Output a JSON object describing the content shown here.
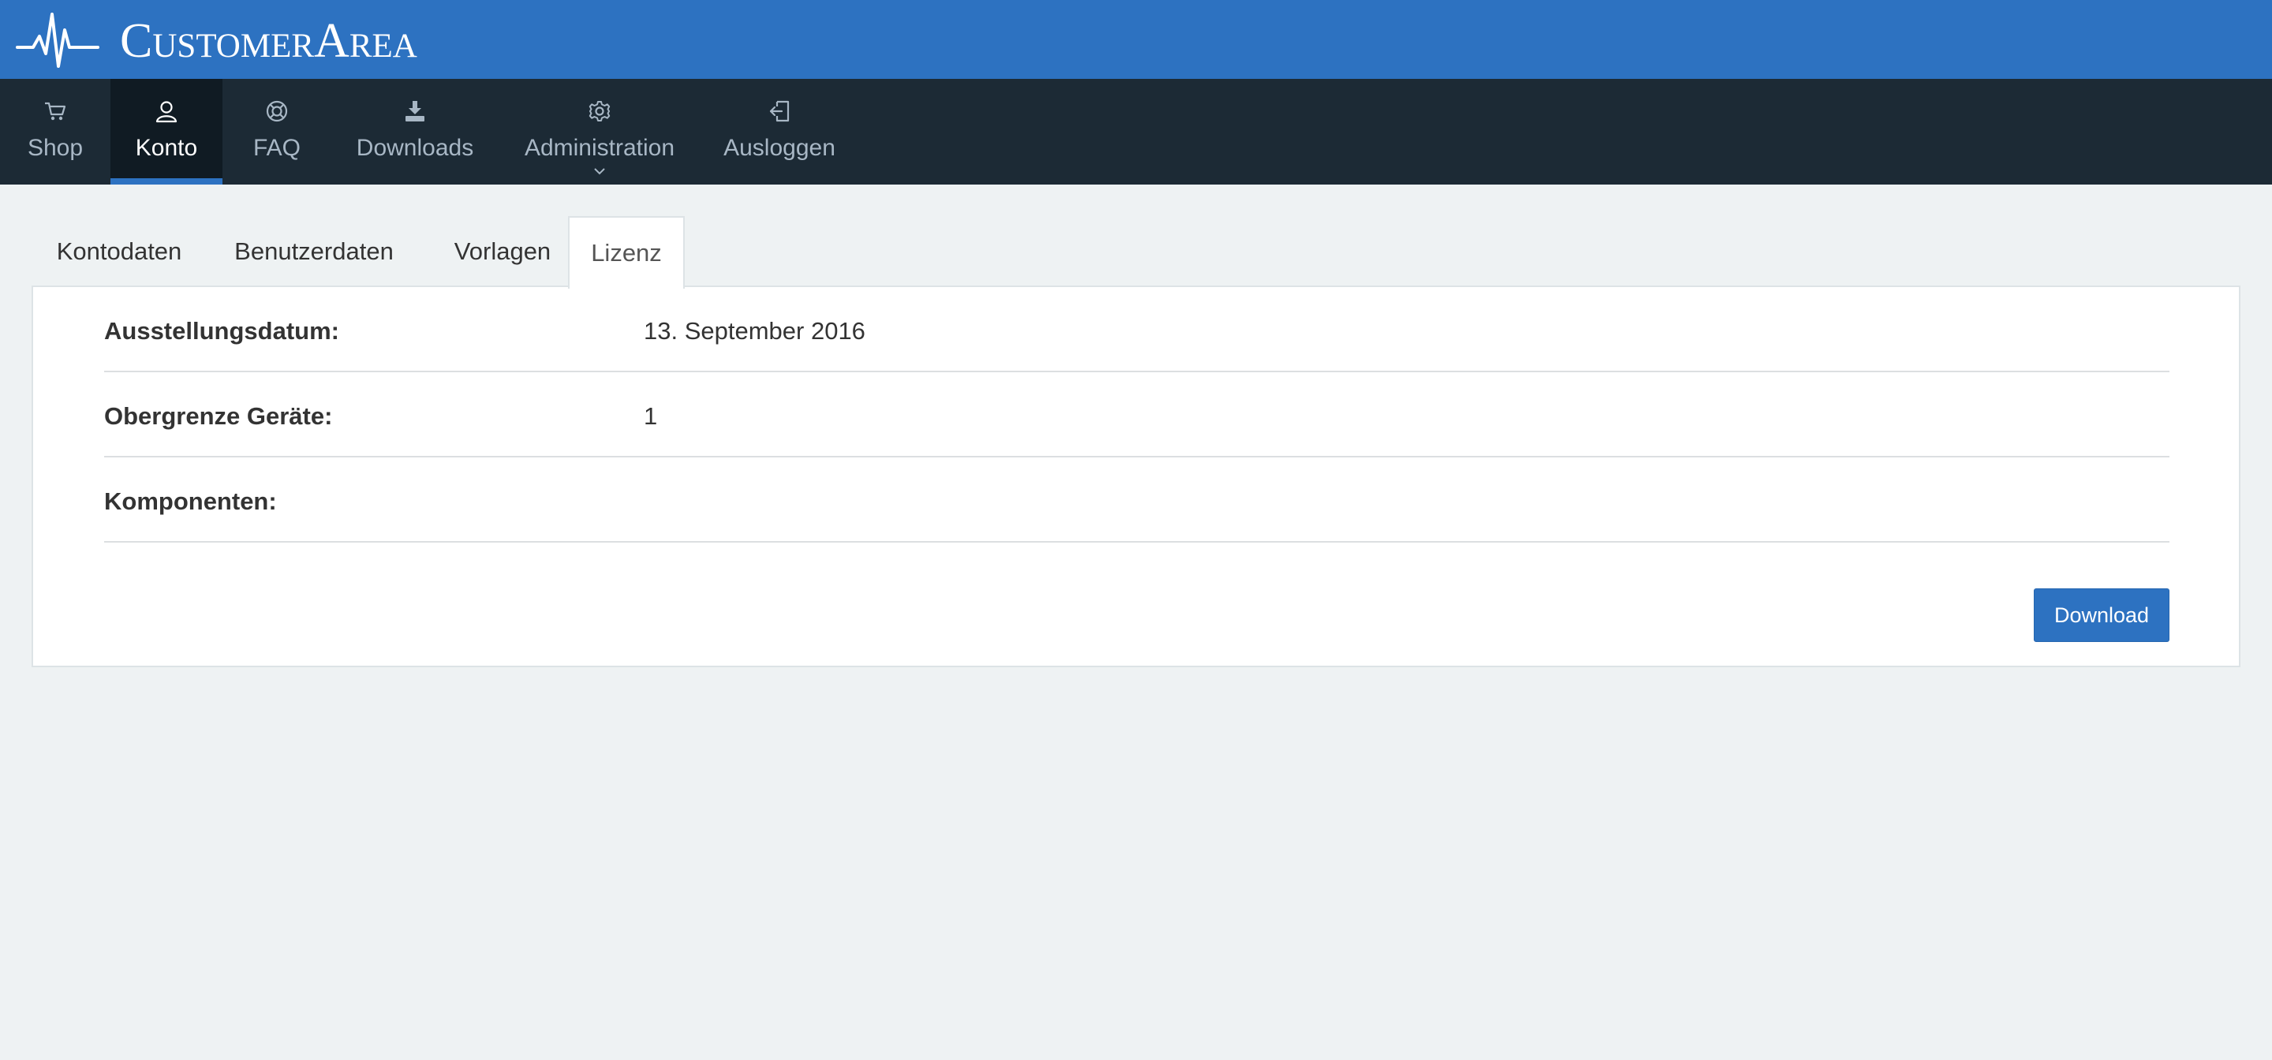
{
  "header": {
    "logo_text": "CustomerArea",
    "logo_icon": "heartbeat-icon"
  },
  "nav": {
    "items": [
      {
        "label": "Shop",
        "icon": "cart-icon"
      },
      {
        "label": "Konto",
        "icon": "user-icon",
        "active": true
      },
      {
        "label": "FAQ",
        "icon": "lifebuoy-icon"
      },
      {
        "label": "Downloads",
        "icon": "download-icon"
      },
      {
        "label": "Administration",
        "icon": "gear-icon",
        "has_dropdown": true
      },
      {
        "label": "Ausloggen",
        "icon": "logout-icon"
      }
    ]
  },
  "tabs": {
    "items": [
      {
        "label": "Kontodaten"
      },
      {
        "label": "Benutzerdaten"
      },
      {
        "label": "Vorlagen"
      },
      {
        "label": "Lizenz",
        "active": true
      }
    ]
  },
  "license": {
    "rows": [
      {
        "label": "Ausstellungsdatum:",
        "value": "13. September 2016"
      },
      {
        "label": "Obergrenze Geräte:",
        "value": "1"
      },
      {
        "label": "Komponenten:",
        "value": ""
      }
    ],
    "download_label": "Download"
  },
  "colors": {
    "brand_blue": "#2d72c1",
    "nav_bg": "#1c2a35",
    "nav_active_bg": "#101b23",
    "page_bg": "#eef2f3"
  }
}
